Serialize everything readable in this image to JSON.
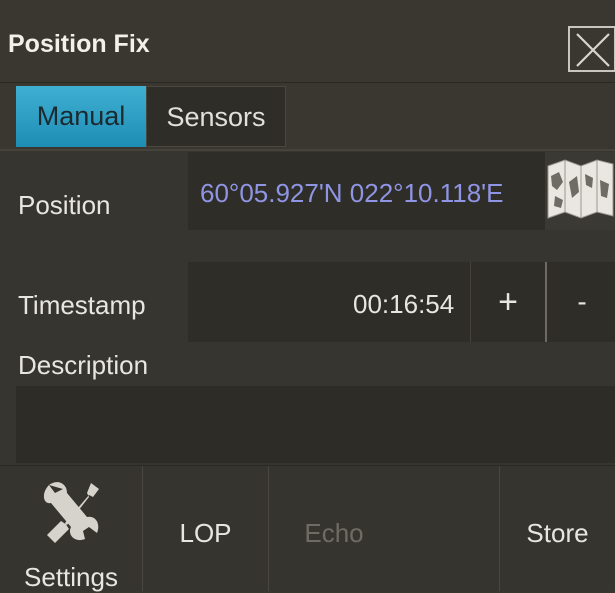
{
  "window": {
    "title": "Position Fix",
    "close_icon": "close-icon"
  },
  "tabs": [
    {
      "label": "Manual",
      "active": true
    },
    {
      "label": "Sensors",
      "active": false
    }
  ],
  "fields": {
    "position": {
      "label": "Position",
      "value": "60°05.927'N 022°10.118'E",
      "map_icon": "map-icon"
    },
    "timestamp": {
      "label": "Timestamp",
      "value": "00:16:54",
      "plus_label": "+",
      "minus_label": "-"
    },
    "description": {
      "label": "Description",
      "value": ""
    }
  },
  "toolbar": {
    "settings_label": "Settings",
    "lop_label": "LOP",
    "echo_label": "Echo",
    "echo_enabled": false,
    "store_label": "Store"
  },
  "colors": {
    "accent": "#2a9fcb",
    "position_text": "#8f95e4",
    "background": "#37352f"
  }
}
